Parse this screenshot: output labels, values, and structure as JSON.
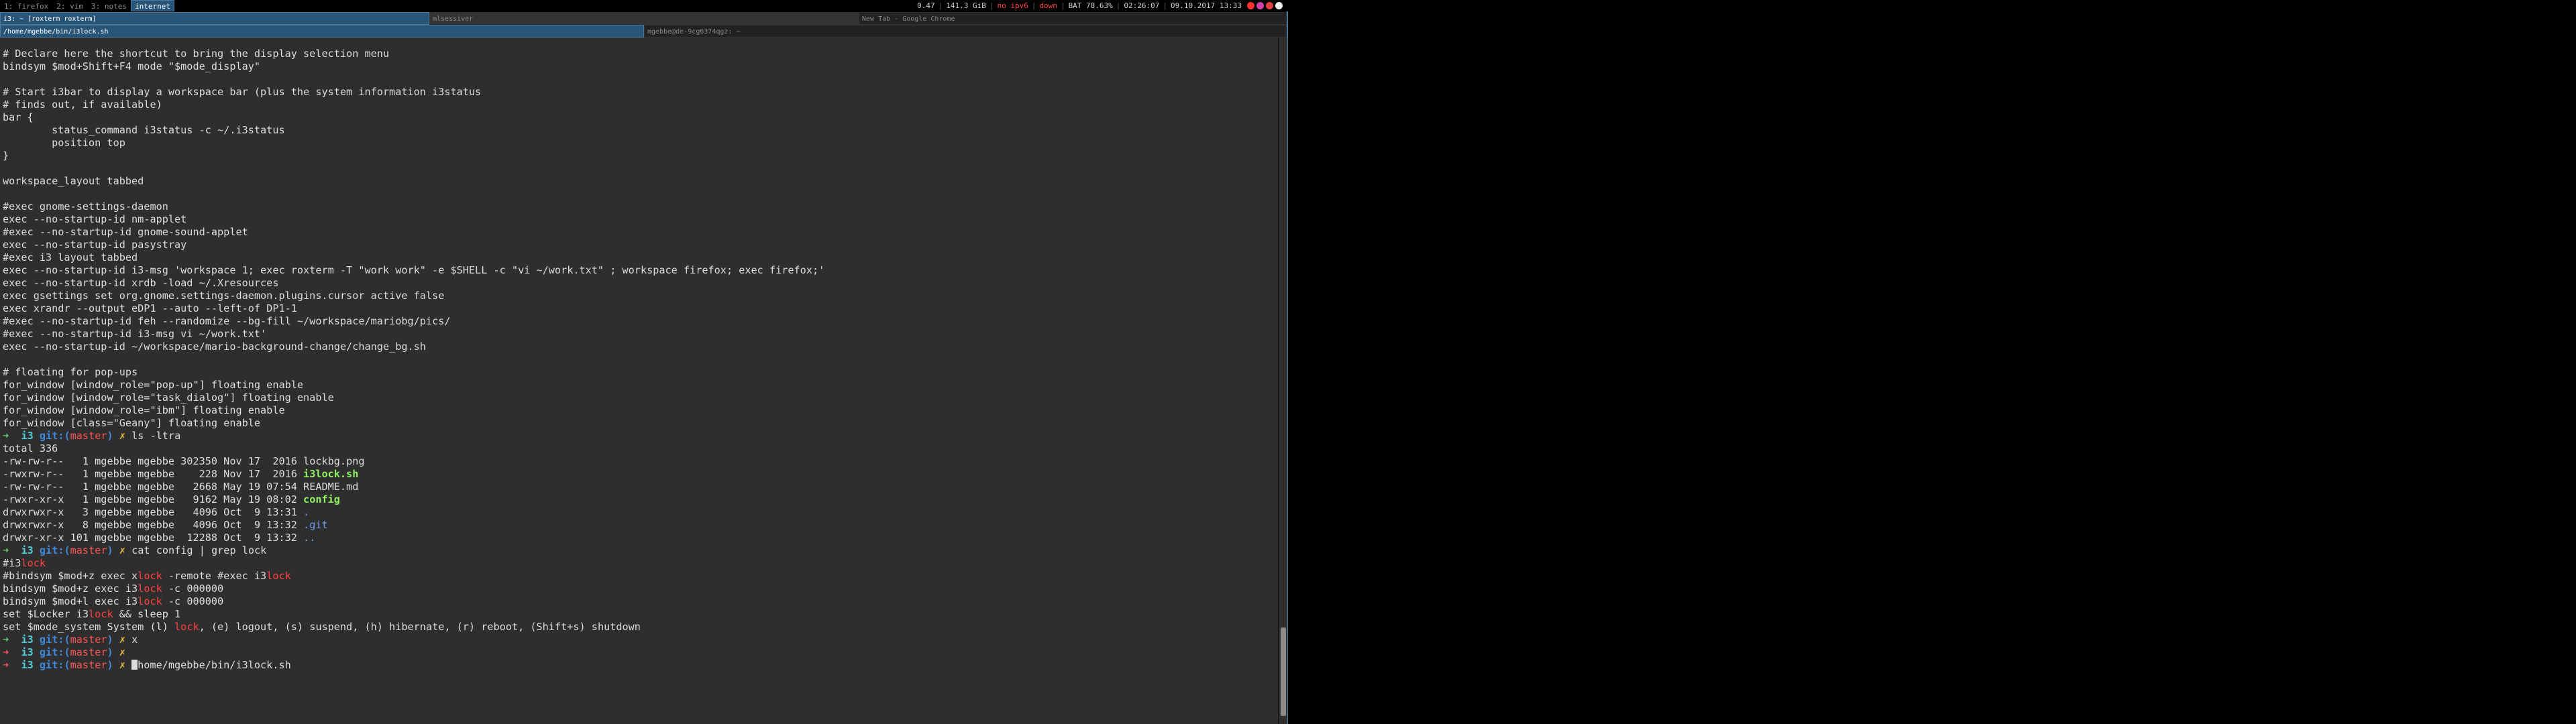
{
  "workspaces": [
    {
      "label": "1: firefox"
    },
    {
      "label": "2: vim"
    },
    {
      "label": "3: notes"
    },
    {
      "label": "internet",
      "active": true
    }
  ],
  "status_items": [
    {
      "text": "0.47",
      "warn": false
    },
    {
      "text": "141.3 GiB",
      "warn": false
    },
    {
      "text": "no ipv6",
      "warn": true
    },
    {
      "text": "down",
      "warn": true
    },
    {
      "text": "BAT 78.63%",
      "warn": false
    },
    {
      "text": "02:26:07",
      "warn": false
    },
    {
      "text": "09.10.2017 13:33",
      "warn": false
    }
  ],
  "tabs_row1": [
    {
      "label": "i3: ~ [roxterm roxterm]",
      "state": "focused"
    },
    {
      "label": "mlsessiver",
      "state": "unfocused"
    },
    {
      "label": "New Tab - Google Chrome",
      "state": "inactive"
    }
  ],
  "tabs_row2": [
    {
      "label": "/home/mgebbe/bin/i3lock.sh",
      "state": "focused"
    },
    {
      "label": "mgebbe@de-9cg6374qgz: ~",
      "state": "inactive"
    }
  ],
  "terminal": {
    "lines": [
      "# Declare here the shortcut to bring the display selection menu",
      "bindsym $mod+Shift+F4 mode \"$mode_display\"",
      "",
      "# Start i3bar to display a workspace bar (plus the system information i3status",
      "# finds out, if available)",
      "bar {",
      "        status_command i3status -c ~/.i3status",
      "        position top",
      "}",
      "",
      "workspace_layout tabbed",
      "",
      "#exec gnome-settings-daemon",
      "exec --no-startup-id nm-applet",
      "#exec --no-startup-id gnome-sound-applet",
      "exec --no-startup-id pasystray",
      "#exec i3 layout tabbed",
      "exec --no-startup-id i3-msg 'workspace 1; exec roxterm -T \"work work\" -e $SHELL -c \"vi ~/work.txt\" ; workspace firefox; exec firefox;'",
      "exec --no-startup-id xrdb -load ~/.Xresources",
      "exec gsettings set org.gnome.settings-daemon.plugins.cursor active false",
      "exec xrandr --output eDP1 --auto --left-of DP1-1",
      "#exec --no-startup-id feh --randomize --bg-fill ~/workspace/mariobg/pics/",
      "#exec --no-startup-id i3-msg vi ~/work.txt'",
      "exec --no-startup-id ~/workspace/mario-background-change/change_bg.sh",
      "",
      "# floating for pop-ups",
      "for_window [window_role=\"pop-up\"] floating enable",
      "for_window [window_role=\"task_dialog\"] floating enable",
      "for_window [window_role=\"ibm\"] floating enable",
      "for_window [class=\"Geany\"] floating enable"
    ],
    "prompt_dir": "i3",
    "prompt_git": "git:",
    "prompt_branch_open": "(",
    "prompt_branch": "master",
    "prompt_branch_close": ")",
    "prompt_x": "✗",
    "prompt_arrow": "➜",
    "cmd1": "ls -ltra",
    "total": "total 336",
    "ls_rows": [
      {
        "perm": "-rw-rw-r--   1 mgebbe mgebbe 302350 Nov 17  2016 ",
        "name": "lockbg.png",
        "kind": "plain"
      },
      {
        "perm": "-rwxrw-r--   1 mgebbe mgebbe    228 Nov 17  2016 ",
        "name": "i3lock.sh",
        "kind": "exe"
      },
      {
        "perm": "-rw-rw-r--   1 mgebbe mgebbe   2668 May 19 07:54 ",
        "name": "README.md",
        "kind": "plain"
      },
      {
        "perm": "-rwxr-xr-x   1 mgebbe mgebbe   9162 May 19 08:02 ",
        "name": "config",
        "kind": "exe"
      },
      {
        "perm": "drwxrwxr-x   3 mgebbe mgebbe   4096 Oct  9 13:31 ",
        "name": ".",
        "kind": "dir"
      },
      {
        "perm": "drwxrwxr-x   8 mgebbe mgebbe   4096 Oct  9 13:32 ",
        "name": ".git",
        "kind": "dir"
      },
      {
        "perm": "drwxr-xr-x 101 mgebbe mgebbe  12288 Oct  9 13:32 ",
        "name": "..",
        "kind": "dir"
      }
    ],
    "cmd2": "cat config | grep lock",
    "grep_rows": [
      [
        {
          "t": "#i3"
        },
        {
          "t": "lock",
          "h": true
        }
      ],
      [
        {
          "t": "#bindsym $mod+z exec x"
        },
        {
          "t": "lock",
          "h": true
        },
        {
          "t": " -remote #exec i3"
        },
        {
          "t": "lock",
          "h": true
        }
      ],
      [
        {
          "t": "bindsym $mod+z exec i3"
        },
        {
          "t": "lock",
          "h": true
        },
        {
          "t": " -c 000000"
        }
      ],
      [
        {
          "t": "bindsym $mod+l exec i3"
        },
        {
          "t": "lock",
          "h": true
        },
        {
          "t": " -c 000000"
        }
      ],
      [
        {
          "t": "set $Locker i3"
        },
        {
          "t": "lock",
          "h": true
        },
        {
          "t": " && sleep 1"
        }
      ],
      [
        {
          "t": "set $mode_system System (l) "
        },
        {
          "t": "lock",
          "h": true
        },
        {
          "t": ", (e) logout, (s) suspend, (h) hibernate, (r) reboot, (Shift+s) shutdown"
        }
      ]
    ],
    "cmd3": "x",
    "cmd5": "home/mgebbe/bin/i3lock.sh"
  }
}
